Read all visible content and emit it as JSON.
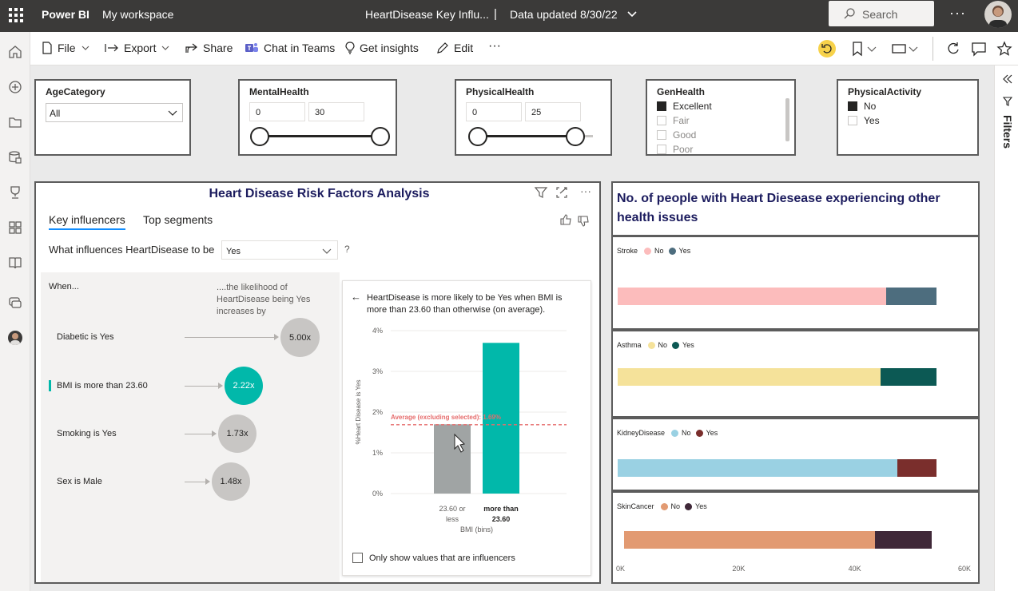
{
  "header": {
    "brand": "Power BI",
    "workspace": "My workspace",
    "report_title": "HeartDisease Key Influ...",
    "separator": "|",
    "data_updated": "Data updated 8/30/22",
    "search_placeholder": "Search",
    "more": "···"
  },
  "toolbar": {
    "file": "File",
    "export": "Export",
    "share": "Share",
    "chat_in_teams": "Chat in Teams",
    "get_insights": "Get insights",
    "edit": "Edit",
    "more": "···"
  },
  "filters_pane": {
    "label": "Filters"
  },
  "slicers": {
    "age": {
      "title": "AgeCategory",
      "value": "All"
    },
    "mental": {
      "title": "MentalHealth",
      "min": "0",
      "max": "30"
    },
    "physical": {
      "title": "PhysicalHealth",
      "min": "0",
      "max": "25"
    },
    "genhealth": {
      "title": "GenHealth",
      "options": [
        {
          "label": "Excellent",
          "checked": true
        },
        {
          "label": "Fair",
          "checked": false
        },
        {
          "label": "Good",
          "checked": false
        },
        {
          "label": "Poor",
          "checked": false
        }
      ]
    },
    "activity": {
      "title": "PhysicalActivity",
      "options": [
        {
          "label": "No",
          "checked": true
        },
        {
          "label": "Yes",
          "checked": false
        }
      ]
    }
  },
  "key_influencers": {
    "title": "Heart Disease Risk Factors Analysis",
    "tabs": [
      "Key influencers",
      "Top segments"
    ],
    "question": "What influences HeartDisease to be",
    "question_value": "Yes",
    "question_help": "?",
    "when_label": "When...",
    "likelihood_label": "....the likelihood of HeartDisease being Yes increases by",
    "influencers": [
      {
        "label": "Diabetic is Yes",
        "value": "5.00x",
        "selected": false
      },
      {
        "label": "BMI is more than 23.60",
        "value": "2.22x",
        "selected": true
      },
      {
        "label": "Smoking is Yes",
        "value": "1.73x",
        "selected": false
      },
      {
        "label": "Sex is Male",
        "value": "1.48x",
        "selected": false
      }
    ],
    "detail": {
      "description": "HeartDisease is more likely to be Yes when BMI is more than 23.60 than otherwise (on average).",
      "only_influencers": "Only show values that are influencers"
    }
  },
  "chart_data": [
    {
      "type": "bar",
      "title": "",
      "xlabel": "BMI (bins)",
      "ylabel": "%Heart Disease is Yes",
      "categories": [
        "23.60 or less",
        "more than 23.60"
      ],
      "values": [
        1.7,
        3.7
      ],
      "ylim": [
        0,
        4
      ],
      "yticks": [
        "0%",
        "1%",
        "2%",
        "3%",
        "4%"
      ],
      "reference_line": {
        "label": "Average (excluding selected): 1.69%",
        "value": 1.69,
        "color": "#e66c6c"
      },
      "colors": [
        "#a0a4a4",
        "#01b8aa"
      ],
      "grid": true
    },
    {
      "type": "bar",
      "orientation": "horizontal-stacked",
      "title": "No. of people with Heart Diesease experiencing other health issues",
      "xticks": [
        "0K",
        "20K",
        "40K",
        "60K"
      ],
      "xlim": [
        0,
        60000
      ],
      "panels": [
        {
          "category": "Stroke",
          "series": [
            {
              "name": "No",
              "value": 47500,
              "color": "#fcbcbc"
            },
            {
              "name": "Yes",
              "value": 9000,
              "color": "#4d6d7e"
            }
          ]
        },
        {
          "category": "Asthma",
          "series": [
            {
              "name": "No",
              "value": 46500,
              "color": "#f5e29a"
            },
            {
              "name": "Yes",
              "value": 10000,
              "color": "#0c5954"
            }
          ]
        },
        {
          "category": "KidneyDisease",
          "series": [
            {
              "name": "No",
              "value": 49500,
              "color": "#9ad1e3"
            },
            {
              "name": "Yes",
              "value": 7000,
              "color": "#7a2e2c"
            }
          ]
        },
        {
          "category": "SkinCancer",
          "series": [
            {
              "name": "No",
              "value": 44500,
              "color": "#e29a72"
            },
            {
              "name": "Yes",
              "value": 10000,
              "color": "#3f2838"
            }
          ]
        }
      ]
    }
  ]
}
